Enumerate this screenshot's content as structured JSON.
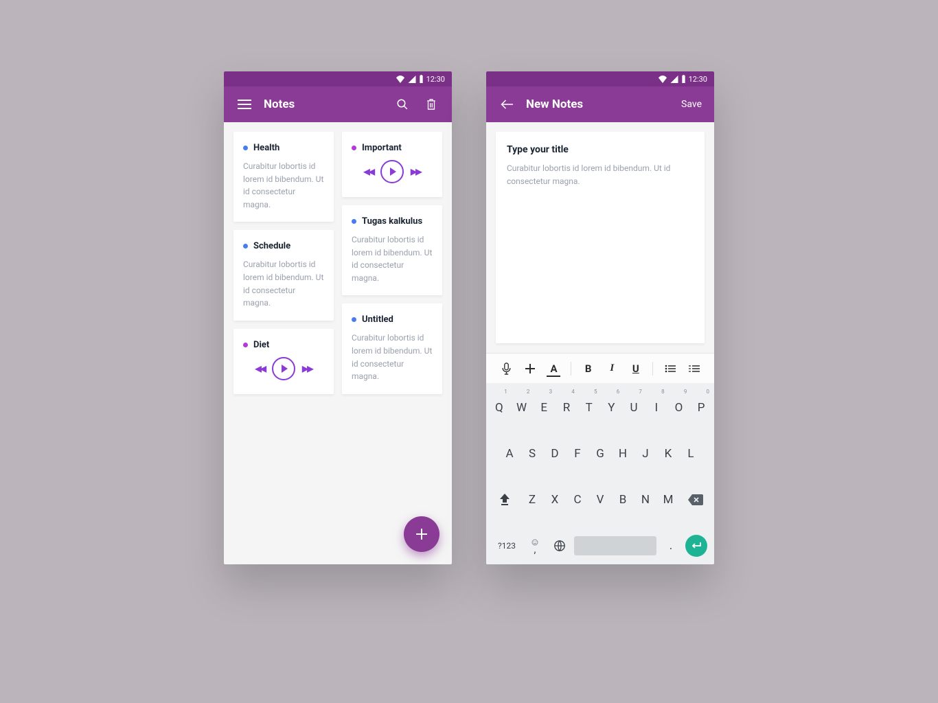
{
  "status": {
    "time": "12:30"
  },
  "phone1": {
    "appbar": {
      "title": "Notes"
    },
    "cards": {
      "health": {
        "title": "Health",
        "body": "Curabitur lobortis id lorem id bibendum. Ut id consectetur magna."
      },
      "important": {
        "title": "Important"
      },
      "schedule": {
        "title": "Schedule",
        "body": "Curabitur lobortis id lorem id bibendum. Ut id consectetur magna."
      },
      "tugas": {
        "title": "Tugas kalkulus",
        "body": "Curabitur lobortis id lorem id bibendum. Ut id consectetur magna."
      },
      "diet": {
        "title": "Diet"
      },
      "untitled": {
        "title": "Untitled",
        "body": "Curabitur lobortis id lorem id bibendum. Ut id consectetur magna."
      }
    }
  },
  "phone2": {
    "appbar": {
      "title": "New Notes",
      "save": "Save"
    },
    "editor": {
      "title_placeholder": "Type your title",
      "body": "Curabitur lobortis id lorem id bibendum. Ut id consectetur magna."
    },
    "toolbar": {
      "text": "A",
      "bold": "B",
      "italic": "I",
      "underline": "U"
    },
    "keyboard": {
      "row1": [
        "Q",
        "W",
        "E",
        "R",
        "T",
        "Y",
        "U",
        "I",
        "O",
        "P"
      ],
      "row1_sup": [
        "1",
        "2",
        "3",
        "4",
        "5",
        "6",
        "7",
        "8",
        "9",
        "0"
      ],
      "row2": [
        "A",
        "S",
        "D",
        "F",
        "G",
        "H",
        "J",
        "K",
        "L"
      ],
      "row3": [
        "Z",
        "X",
        "C",
        "V",
        "B",
        "N",
        "M"
      ],
      "sym": "?123",
      "comma": ",",
      "period": "."
    }
  }
}
